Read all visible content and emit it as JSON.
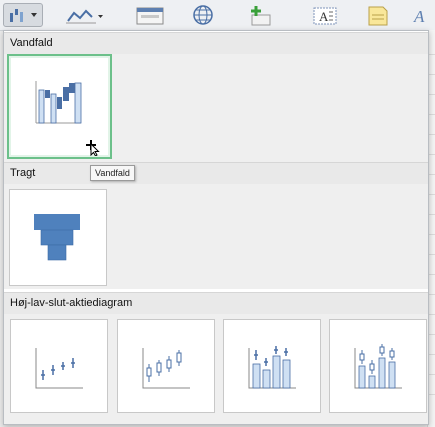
{
  "toolbar": {
    "buttons": [
      {
        "name": "chart-type-dropdown-button",
        "icon": "waterfall-chart-icon"
      },
      {
        "name": "sparkline-button",
        "icon": "line-chart-icon"
      },
      {
        "name": "form-button",
        "icon": "form-icon"
      },
      {
        "name": "globe-button",
        "icon": "globe-icon"
      },
      {
        "name": "insert-shape-button",
        "icon": "plus-shape-icon"
      },
      {
        "name": "textbox-button",
        "icon": "textbox-icon"
      },
      {
        "name": "note-button",
        "icon": "note-icon"
      },
      {
        "name": "wordart-button",
        "icon": "wordart-icon"
      }
    ]
  },
  "sections": {
    "waterfall": {
      "title": "Vandfald"
    },
    "funnel": {
      "title": "Tragt"
    },
    "stock": {
      "title": "Høj-lav-slut-aktiediagram"
    }
  },
  "tooltip": {
    "text": "Vandfald"
  },
  "colors": {
    "chart_blue": "#4a6fa5",
    "chart_light_blue": "#cfe0f3",
    "funnel_blue": "#4f81bd",
    "selection_green": "#6cc08a",
    "icon_green": "#3aa03a"
  }
}
